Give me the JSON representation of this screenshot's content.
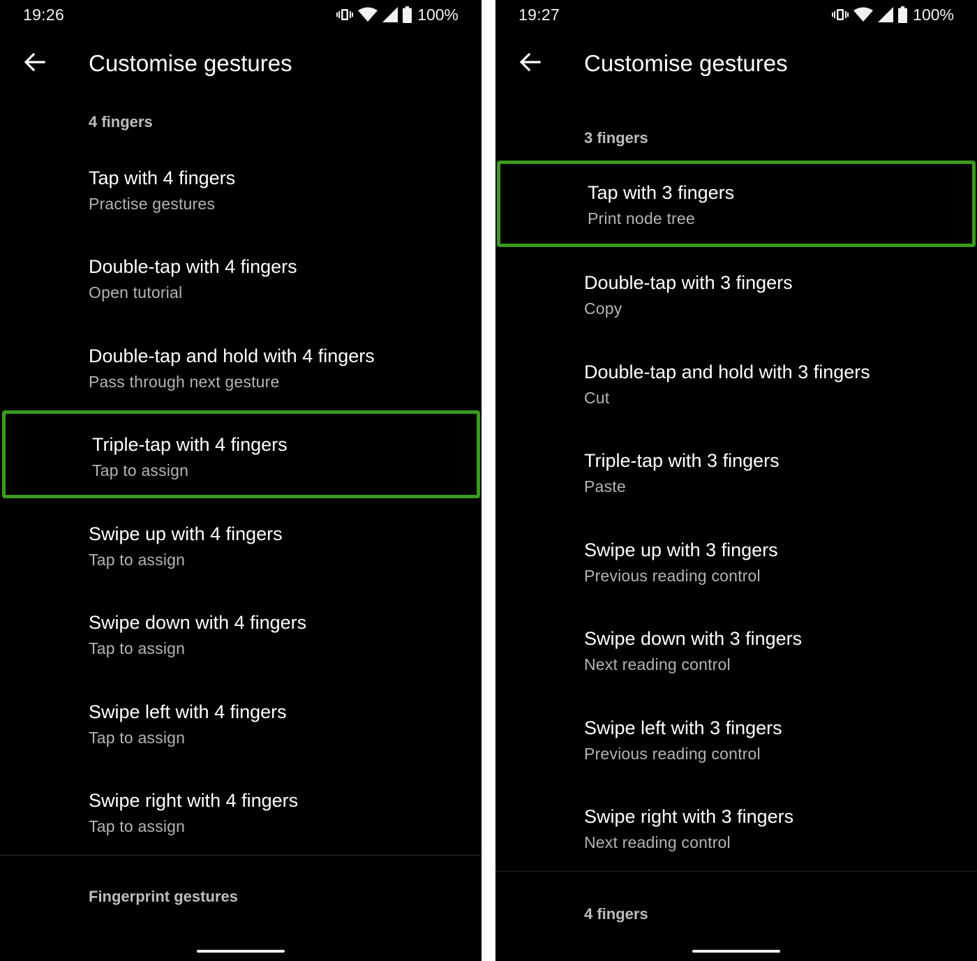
{
  "colors": {
    "screen_bg": "#000000",
    "highlight_border": "#3a9a1e",
    "summary_text": "#b4b4b4",
    "header_text": "#bdbdbd"
  },
  "left": {
    "status": {
      "time": "19:26",
      "battery": "100%",
      "icons": [
        "vibrate-icon",
        "wifi-icon",
        "cell-signal-icon",
        "battery-icon"
      ]
    },
    "header": {
      "title": "Customise gestures",
      "back_icon": "back-arrow-icon"
    },
    "section": "4 fingers",
    "items": [
      {
        "label": "Tap with 4 fingers",
        "summary": "Practise gestures"
      },
      {
        "label": "Double-tap with 4 fingers",
        "summary": "Open tutorial"
      },
      {
        "label": "Double-tap and hold with 4 fingers",
        "summary": "Pass through next gesture"
      },
      {
        "label": "Triple-tap with 4 fingers",
        "summary": "Tap to assign",
        "highlighted": true
      },
      {
        "label": "Swipe up with 4 fingers",
        "summary": "Tap to assign"
      },
      {
        "label": "Swipe down with 4 fingers",
        "summary": "Tap to assign"
      },
      {
        "label": "Swipe left with 4 fingers",
        "summary": "Tap to assign"
      },
      {
        "label": "Swipe right with 4 fingers",
        "summary": "Tap to assign"
      }
    ],
    "next_section": "Fingerprint gestures"
  },
  "right": {
    "status": {
      "time": "19:27",
      "battery": "100%",
      "icons": [
        "vibrate-icon",
        "wifi-icon",
        "cell-signal-icon",
        "battery-icon"
      ]
    },
    "header": {
      "title": "Customise gestures",
      "back_icon": "back-arrow-icon"
    },
    "section": "3 fingers",
    "items": [
      {
        "label": "Tap with 3 fingers",
        "summary": "Print node tree",
        "highlighted": true
      },
      {
        "label": "Double-tap with 3 fingers",
        "summary": "Copy"
      },
      {
        "label": "Double-tap and hold with 3 fingers",
        "summary": "Cut"
      },
      {
        "label": "Triple-tap with 3 fingers",
        "summary": "Paste"
      },
      {
        "label": "Swipe up with 3 fingers",
        "summary": "Previous reading control"
      },
      {
        "label": "Swipe down with 3 fingers",
        "summary": "Next reading control"
      },
      {
        "label": "Swipe left with 3 fingers",
        "summary": "Previous reading control"
      },
      {
        "label": "Swipe right with 3 fingers",
        "summary": "Next reading control"
      }
    ],
    "next_section": "4 fingers"
  }
}
